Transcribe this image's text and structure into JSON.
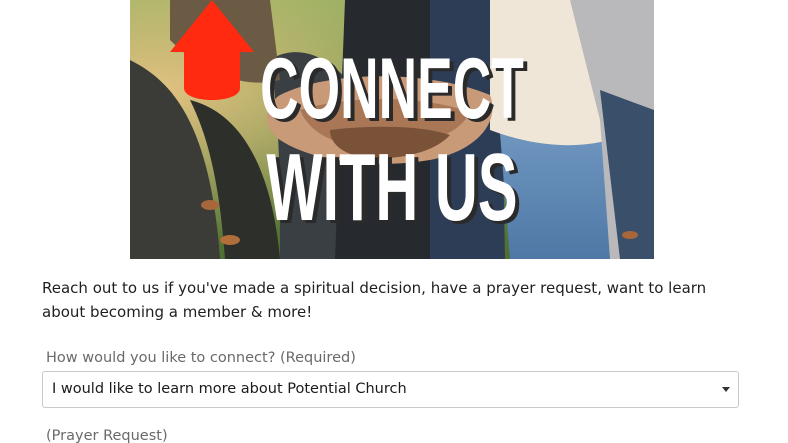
{
  "hero": {
    "title_line1": "CONNECT",
    "title_line2": "WITH US"
  },
  "intro": {
    "text": "Reach out to us if you've made a spiritual decision, have a prayer request, want to learn about becoming a member & more!"
  },
  "form": {
    "connect_label": "How would you like to connect? (Required)",
    "connect_value": "I would like to learn more about Potential Church",
    "prayer_label": "(Prayer Request)"
  },
  "colors": {
    "arrow": "#ff2a10",
    "title_fill": "#ffffff",
    "title_shadow": "#2a2a2a"
  }
}
